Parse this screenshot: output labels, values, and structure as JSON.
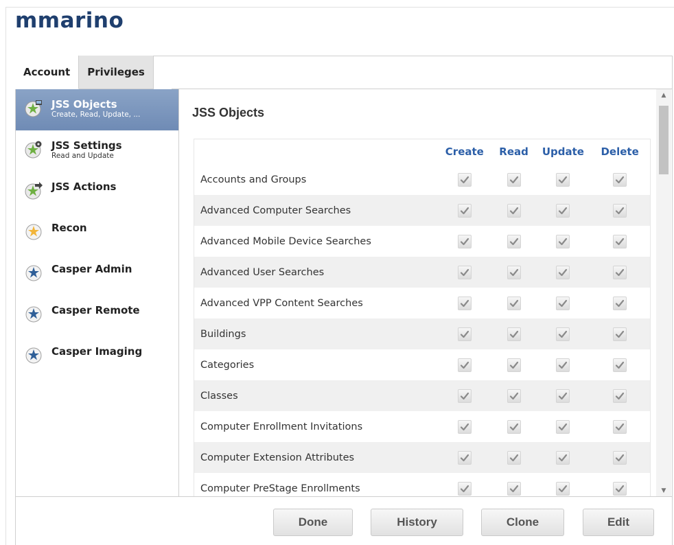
{
  "account": {
    "title": "mmarino"
  },
  "tabs": [
    {
      "label": "Account"
    },
    {
      "label": "Privileges"
    }
  ],
  "sidebar": {
    "items": [
      {
        "label": "JSS Objects",
        "sub": "Create, Read, Update, ...",
        "icon": "jss-objects-icon"
      },
      {
        "label": "JSS Settings",
        "sub": "Read and Update",
        "icon": "jss-settings-icon"
      },
      {
        "label": "JSS Actions",
        "sub": "",
        "icon": "jss-actions-icon"
      },
      {
        "label": "Recon",
        "sub": "",
        "icon": "recon-icon"
      },
      {
        "label": "Casper Admin",
        "sub": "",
        "icon": "casper-admin-icon"
      },
      {
        "label": "Casper Remote",
        "sub": "",
        "icon": "casper-remote-icon"
      },
      {
        "label": "Casper Imaging",
        "sub": "",
        "icon": "casper-imaging-icon"
      }
    ]
  },
  "main": {
    "section_title": "JSS Objects",
    "columns": [
      "Create",
      "Read",
      "Update",
      "Delete"
    ],
    "rows": [
      {
        "name": "Accounts and Groups",
        "create": true,
        "read": true,
        "update": true,
        "delete": true
      },
      {
        "name": "Advanced Computer Searches",
        "create": true,
        "read": true,
        "update": true,
        "delete": true
      },
      {
        "name": "Advanced Mobile Device Searches",
        "create": true,
        "read": true,
        "update": true,
        "delete": true
      },
      {
        "name": "Advanced User Searches",
        "create": true,
        "read": true,
        "update": true,
        "delete": true
      },
      {
        "name": "Advanced VPP Content Searches",
        "create": true,
        "read": true,
        "update": true,
        "delete": true
      },
      {
        "name": "Buildings",
        "create": true,
        "read": true,
        "update": true,
        "delete": true
      },
      {
        "name": "Categories",
        "create": true,
        "read": true,
        "update": true,
        "delete": true
      },
      {
        "name": "Classes",
        "create": true,
        "read": true,
        "update": true,
        "delete": true
      },
      {
        "name": "Computer Enrollment Invitations",
        "create": true,
        "read": true,
        "update": true,
        "delete": true
      },
      {
        "name": "Computer Extension Attributes",
        "create": true,
        "read": true,
        "update": true,
        "delete": true
      },
      {
        "name": "Computer PreStage Enrollments",
        "create": true,
        "read": true,
        "update": true,
        "delete": true
      }
    ]
  },
  "footer": {
    "done": "Done",
    "history": "History",
    "clone": "Clone",
    "edit": "Edit"
  },
  "colors": {
    "title": "#1f3f6e",
    "column_header": "#2c5fa8",
    "selected_item": "#7b95bd"
  }
}
